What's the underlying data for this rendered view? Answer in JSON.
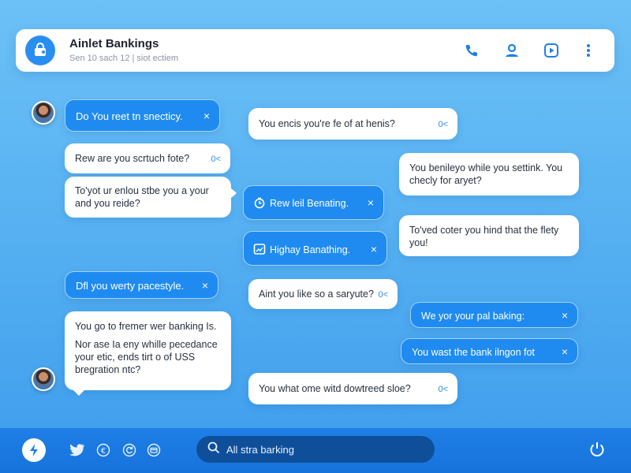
{
  "header": {
    "title": "Ainlet Bankings",
    "subtitle": "Sen 10 sach 12 | siot ectiem",
    "icons": [
      "phone-icon",
      "contact-icon",
      "video-icon",
      "more-icon"
    ]
  },
  "messages": [
    {
      "text": "Do You reet tn snecticy.",
      "action": "×"
    },
    {
      "text": "Rew are you scrtuch fote?",
      "action": "0<"
    },
    {
      "line1": "To'yot ur enlou stbe you a your",
      "line2": "and you reide?"
    },
    {
      "text": "You encis you're fe of at henis?",
      "action": "0<"
    },
    {
      "line1": "You benileyo while you settink. You",
      "line2": "checly for aryet?"
    },
    {
      "text": "Rew leil Benating.",
      "action": "×"
    },
    {
      "text": "Highay Banathing.",
      "action": "×"
    },
    {
      "line1": "To'ved coter you hind that the flety",
      "line2": "you!"
    },
    {
      "text": "Dfl you werty pacestyle.",
      "action": "×"
    },
    {
      "text": "Aint you like so a saryute?",
      "action": "0<"
    },
    {
      "text": "We yor your pal baking:",
      "action": "×"
    },
    {
      "text": "You wast the bank ilngon fot",
      "action": "×"
    },
    {
      "line1": "You go to fremer wer banking Is.",
      "line2": "Nor ase Ia eny whille pecedance",
      "line3": "your etic, ends tirt o of USS",
      "line4": "bregration ntc?"
    },
    {
      "text": "You what ome witd dowtreed sloe?",
      "action": "0<"
    }
  ],
  "bottombar": {
    "search_placeholder": "All stra barking",
    "icons": [
      "bolt-icon",
      "bird-icon",
      "euro-icon",
      "refresh-icon",
      "card-icon",
      "search-icon",
      "power-icon"
    ]
  },
  "colors": {
    "accent": "#1f8bf0",
    "background_top": "#6cc1f6",
    "bottombar": "#1673db"
  }
}
